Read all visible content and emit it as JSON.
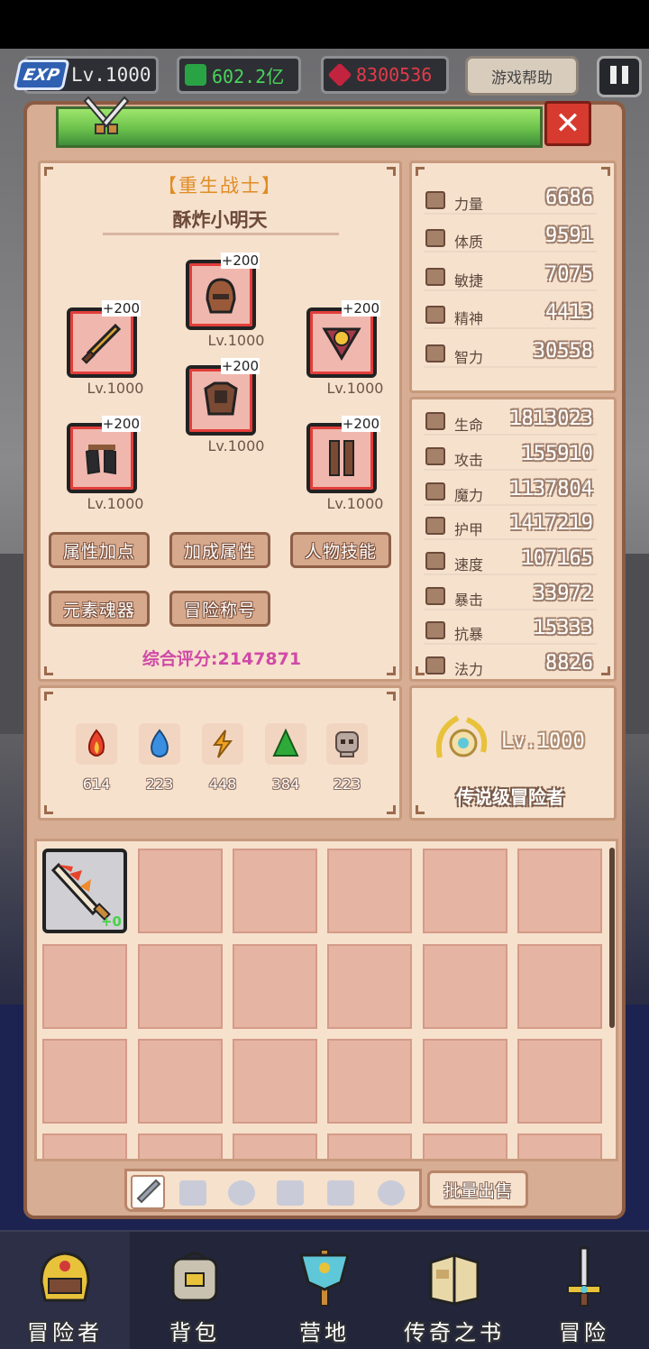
{
  "topbar": {
    "exp_badge": "EXP",
    "level": "Lv.1000",
    "green_currency": "602.2亿",
    "red_currency": "8300536",
    "help_label": "游戏帮助"
  },
  "character": {
    "class_title": "【重生战士】",
    "name": "酥炸小明天",
    "score_label": "综合评分:2147871"
  },
  "equipment": [
    {
      "slot": "weapon",
      "plus": "+200",
      "level": "Lv.1000"
    },
    {
      "slot": "helmet",
      "plus": "+200",
      "level": "Lv.1000"
    },
    {
      "slot": "amulet",
      "plus": "+200",
      "level": "Lv.1000"
    },
    {
      "slot": "armor",
      "plus": "+200",
      "level": "Lv.1000"
    },
    {
      "slot": "gloves",
      "plus": "+200",
      "level": "Lv.1000"
    },
    {
      "slot": "boots",
      "plus": "+200",
      "level": "Lv.1000"
    }
  ],
  "buttons": {
    "attr_points": "属性加点",
    "bonus_attr": "加成属性",
    "char_skills": "人物技能",
    "element_soul": "元素魂器",
    "adventure_title": "冒险称号"
  },
  "elements": [
    {
      "name": "fire",
      "value": "614",
      "color": "#e8442a"
    },
    {
      "name": "water",
      "value": "223",
      "color": "#3b8fe0"
    },
    {
      "name": "lightning",
      "value": "448",
      "color": "#f0a020"
    },
    {
      "name": "earth",
      "value": "384",
      "color": "#2faa3a"
    },
    {
      "name": "dark",
      "value": "223",
      "color": "#8a7a74"
    }
  ],
  "base_stats": [
    {
      "label": "力量",
      "value": "6686"
    },
    {
      "label": "体质",
      "value": "9591"
    },
    {
      "label": "敏捷",
      "value": "7075"
    },
    {
      "label": "精神",
      "value": "4413"
    },
    {
      "label": "智力",
      "value": "30558"
    }
  ],
  "combat_stats": [
    {
      "label": "生命",
      "value": "1813023"
    },
    {
      "label": "攻击",
      "value": "155910"
    },
    {
      "label": "魔力",
      "value": "1137804"
    },
    {
      "label": "护甲",
      "value": "1417219"
    },
    {
      "label": "速度",
      "value": "107165"
    },
    {
      "label": "暴击",
      "value": "33972"
    },
    {
      "label": "抗暴",
      "value": "15333"
    },
    {
      "label": "法力",
      "value": "8826"
    }
  ],
  "rank": {
    "level": "Lv.1000",
    "title": "传说级冒险者"
  },
  "inventory": {
    "first_item_plus": "+0",
    "bulk_sell": "批量出售"
  },
  "nav": [
    {
      "label": "冒险者"
    },
    {
      "label": "背包"
    },
    {
      "label": "营地"
    },
    {
      "label": "传奇之书"
    },
    {
      "label": "冒险"
    }
  ]
}
